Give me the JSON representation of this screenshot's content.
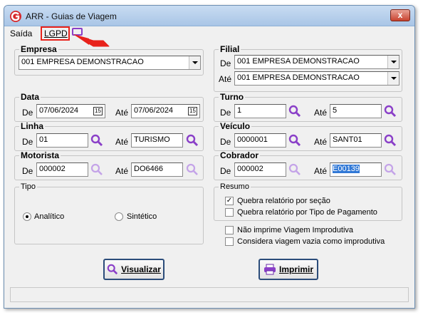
{
  "window": {
    "title": "ARR - Guias de Viagem",
    "close_symbol": "x"
  },
  "menu": {
    "saida": "Saída",
    "lgpd": "LGPD",
    "screen_icon": "screen-icon"
  },
  "empresa": {
    "legend": "Empresa",
    "value": "001 EMPRESA DEMONSTRACAO"
  },
  "filial": {
    "legend": "Filial",
    "de_label": "De",
    "ate_label": "Até",
    "de_value": "001 EMPRESA DEMONSTRACAO",
    "ate_value": "001 EMPRESA DEMONSTRACAO"
  },
  "data": {
    "legend": "Data",
    "de_label": "De",
    "ate_label": "Até",
    "de_value": "07/06/2024",
    "ate_value": "07/06/2024",
    "cal_icon_text": "15"
  },
  "turno": {
    "legend": "Turno",
    "de_label": "De",
    "ate_label": "Até",
    "de_value": "1",
    "ate_value": "5"
  },
  "linha": {
    "legend": "Linha",
    "de_label": "De",
    "ate_label": "Até",
    "de_value": "01",
    "ate_value": "TURISMO"
  },
  "veiculo": {
    "legend": "Veículo",
    "de_label": "De",
    "ate_label": "Até",
    "de_value": "0000001",
    "ate_value": "SANT01"
  },
  "motorista": {
    "legend": "Motorista",
    "de_label": "De",
    "ate_label": "Até",
    "de_value": "000002",
    "ate_value": "DO6466"
  },
  "cobrador": {
    "legend": "Cobrador",
    "de_label": "De",
    "ate_label": "Até",
    "de_value": "000002",
    "ate_value": "E00139"
  },
  "tipo": {
    "legend": "Tipo",
    "analitico": "Analítico",
    "sintetico": "Sintético",
    "selected": "Analítico"
  },
  "resumo": {
    "legend": "Resumo",
    "quebra_secao": "Quebra relatório por seção",
    "quebra_secao_checked": true,
    "quebra_pagamento": "Quebra relatório por Tipo de Pagamento",
    "quebra_pagamento_checked": false
  },
  "options": {
    "nao_imprime": "Não imprime Viagem Improdutiva",
    "considera_vazia": "Considera viagem vazia como improdutiva"
  },
  "buttons": {
    "visualizar": "Visualizar",
    "imprimir": "Imprimir"
  },
  "colors": {
    "accent_purple": "#8a3fc8",
    "highlight_red": "#e8221b",
    "selection_blue": "#3078d6"
  },
  "status": {
    "text": ""
  }
}
